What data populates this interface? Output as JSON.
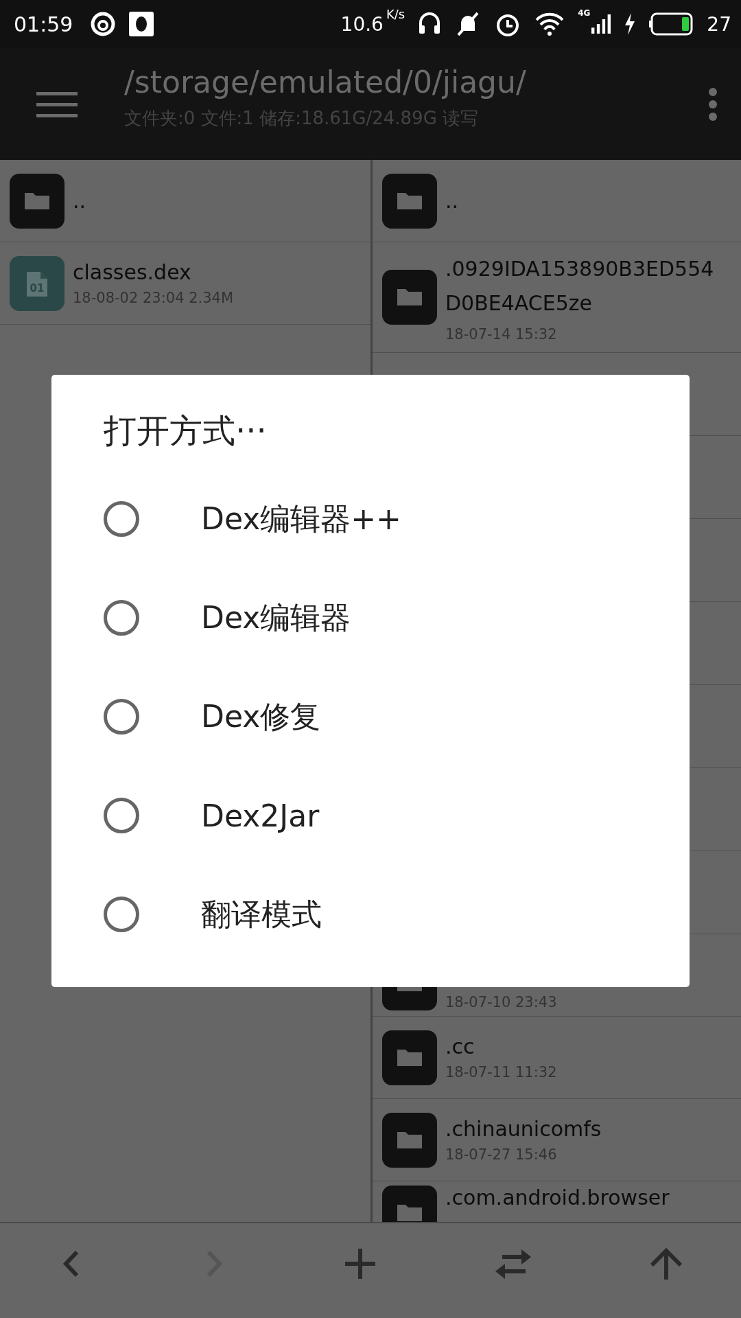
{
  "status_bar": {
    "time": "01:59",
    "net_speed": "10.6",
    "net_unit": "K/s",
    "network_type": "4G",
    "battery": "27"
  },
  "header": {
    "path": "/storage/emulated/0/jiagu/",
    "info": "文件夹:0 文件:1 储存:18.61G/24.89G 读写"
  },
  "left_pane": {
    "rows": [
      {
        "kind": "folder",
        "name": ".."
      },
      {
        "kind": "file",
        "name": "classes.dex",
        "meta": "18-08-02 23:04  2.34M",
        "icon_text": "01"
      }
    ]
  },
  "right_pane": {
    "top_rows": [
      {
        "kind": "folder",
        "name": ".."
      },
      {
        "kind": "folder",
        "name": ".0929IDA153890B3ED554D0BE4ACE5ze",
        "meta": "18-07-14 15:32"
      }
    ],
    "bottom_rows": [
      {
        "kind": "folder",
        "meta": "18-07-10 23:43"
      },
      {
        "kind": "folder",
        "name": ".cc",
        "meta": "18-07-11 11:32"
      },
      {
        "kind": "folder",
        "name": ".chinaunicomfs",
        "meta": "18-07-27 15:46"
      },
      {
        "kind": "folder",
        "name": ".com.android.browser"
      }
    ]
  },
  "dialog": {
    "title": "打开方式···",
    "options": [
      {
        "label": "Dex编辑器++",
        "selected": false
      },
      {
        "label": "Dex编辑器",
        "selected": false
      },
      {
        "label": "Dex修复",
        "selected": false
      },
      {
        "label": "Dex2Jar",
        "selected": false
      },
      {
        "label": "翻译模式",
        "selected": false
      }
    ]
  },
  "bottom_bar": {
    "buttons": [
      {
        "kind": "back",
        "disabled": false
      },
      {
        "kind": "forward",
        "disabled": true
      },
      {
        "kind": "add",
        "disabled": false
      },
      {
        "kind": "swap",
        "disabled": false
      },
      {
        "kind": "up",
        "disabled": false
      }
    ]
  }
}
